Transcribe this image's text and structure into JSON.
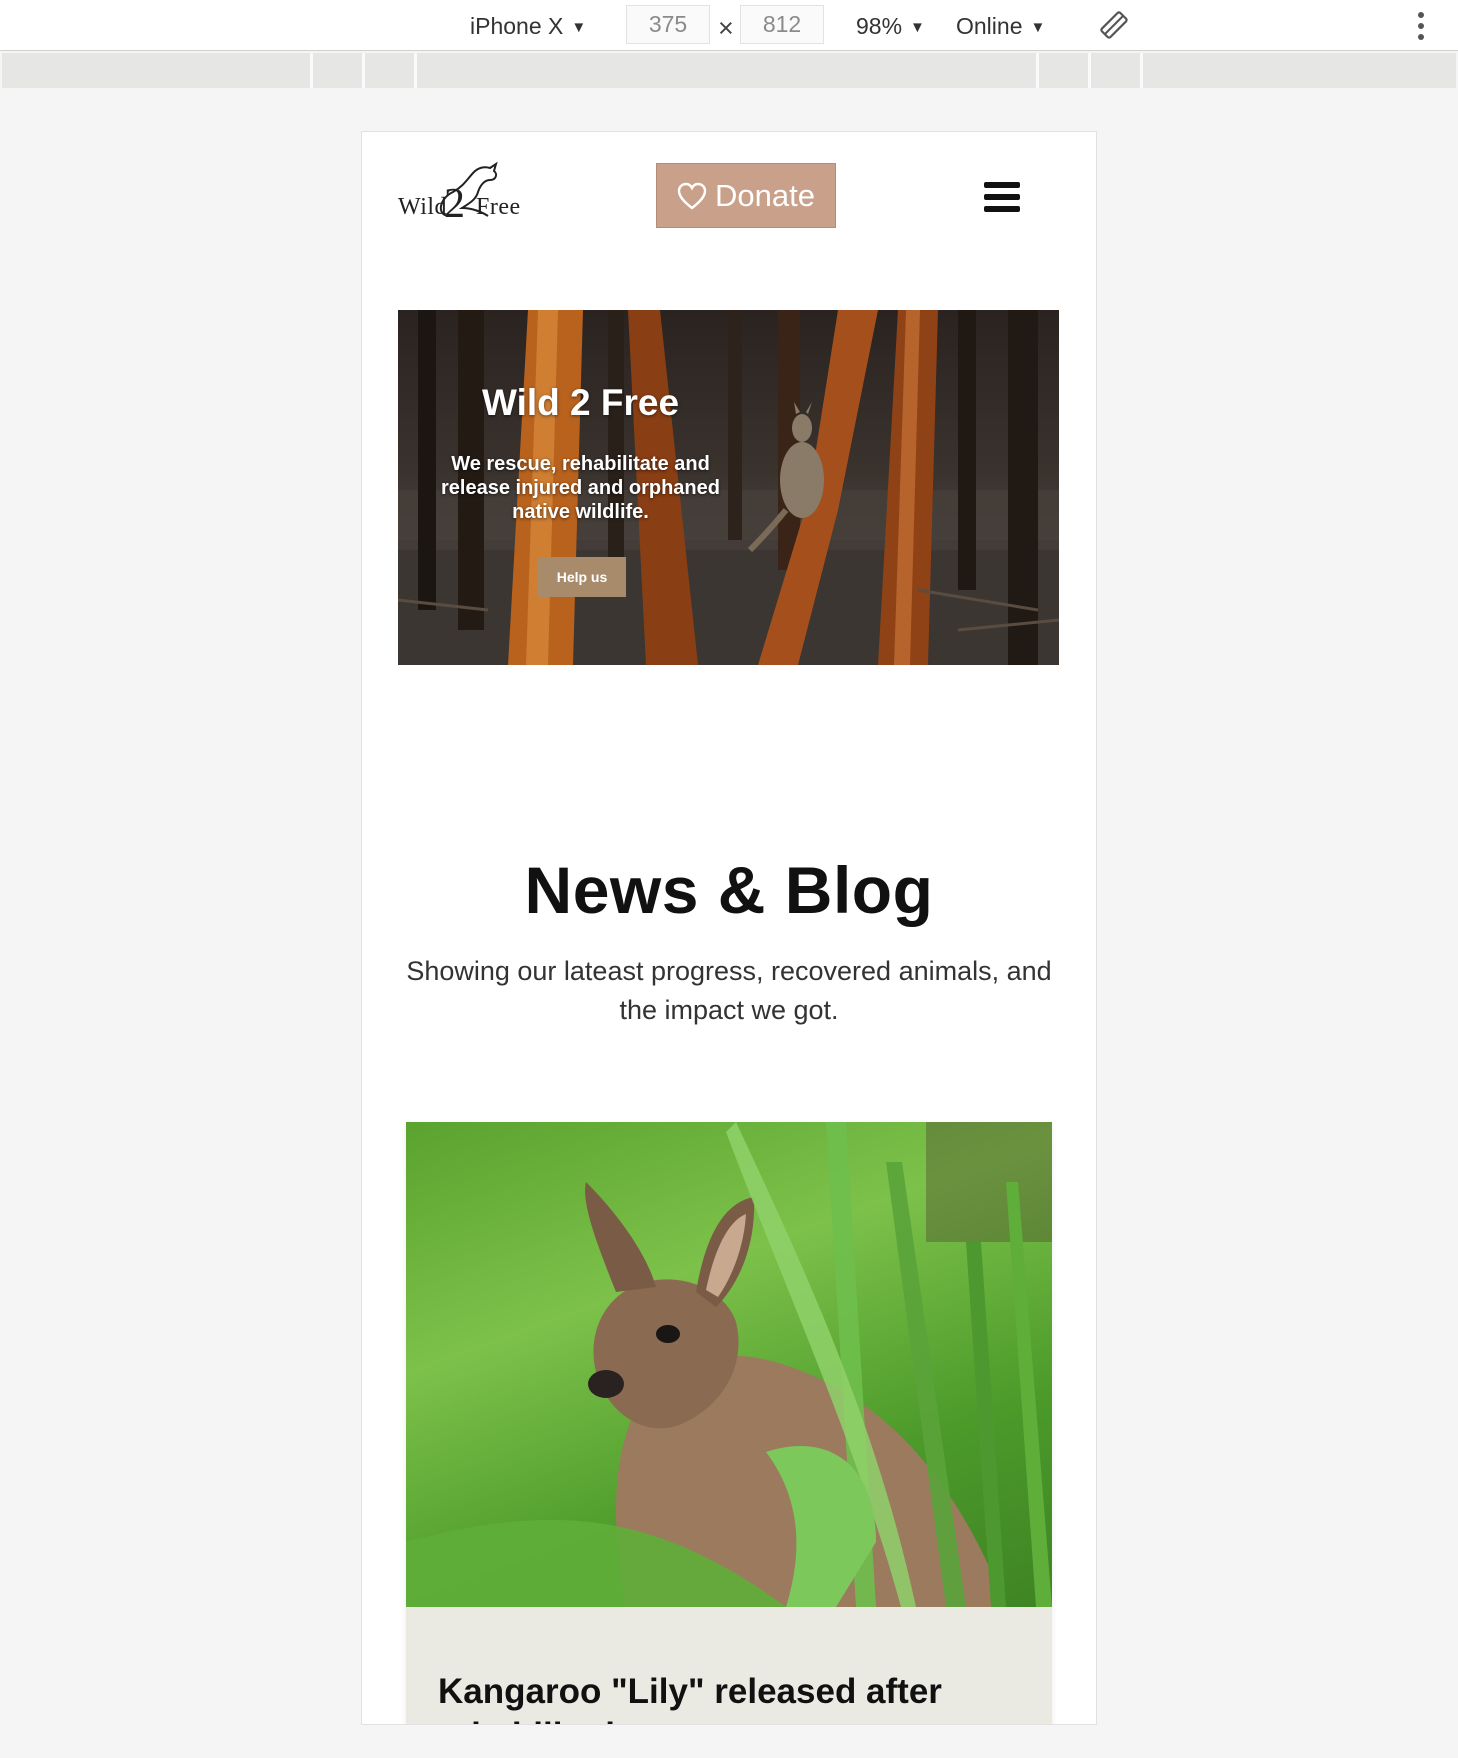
{
  "devtools": {
    "device": "iPhone X",
    "width": "375",
    "height": "812",
    "zoom": "98%",
    "network": "Online",
    "rotate_icon": "rotate-icon",
    "menu_icon": "kebab-menu-icon"
  },
  "site": {
    "logo": {
      "left": "Wild",
      "middle": "2",
      "right": "Free"
    },
    "donate_label": "Donate",
    "donate_icon": "heart-icon",
    "menu_icon": "hamburger-icon",
    "accent": "#c9a089"
  },
  "hero": {
    "title": "Wild 2 Free",
    "text": "We rescue, rehabilitate and release injured and orphaned native wildlife.",
    "button": "Help us",
    "button_color": "#a88b6a"
  },
  "news": {
    "title": "News & Blog",
    "subtitle": "Showing our lateast progress, recovered animals, and the impact we got.",
    "posts": [
      {
        "title": "Kangaroo \"Lily\" released after rehabilitation"
      }
    ]
  }
}
